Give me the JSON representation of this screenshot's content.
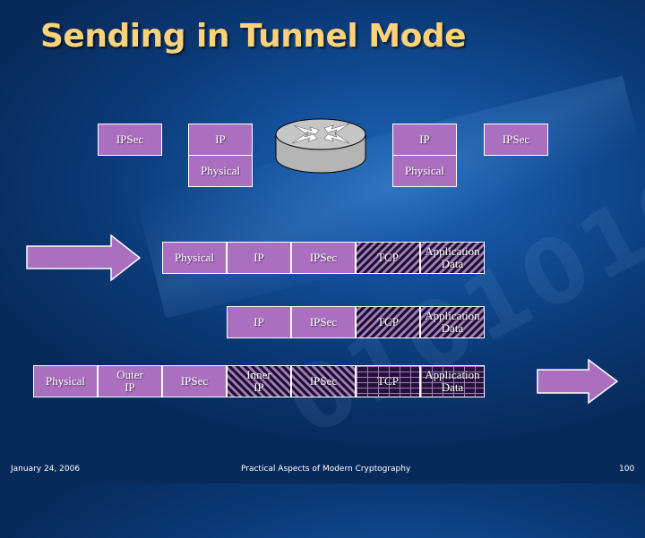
{
  "slide": {
    "title": "Sending in Tunnel Mode",
    "footer": {
      "date": "January 24, 2006",
      "course": "Practical Aspects of Modern Cryptography",
      "page_number": "100"
    }
  },
  "colors": {
    "title": "#fcd27a",
    "layer_fill": "#ab6fc0",
    "border": "#ffffff",
    "background": "#134f99"
  },
  "top_stack": {
    "left_ipsec": "IPSec",
    "left_ip": "IP",
    "left_physical": "Physical",
    "router_icon": "router-icon",
    "right_ip": "IP",
    "right_physical": "Physical",
    "right_ipsec": "IPSec"
  },
  "packets": {
    "row1": [
      {
        "label": "Physical",
        "pattern": "solid"
      },
      {
        "label": "IP",
        "pattern": "solid"
      },
      {
        "label": "IPSec",
        "pattern": "solid"
      },
      {
        "label": "TCP",
        "pattern": "hatch-forward"
      },
      {
        "label": "Application\nData",
        "pattern": "hatch-forward"
      }
    ],
    "row2": [
      {
        "label": "IP",
        "pattern": "solid"
      },
      {
        "label": "IPSec",
        "pattern": "solid"
      },
      {
        "label": "TCP",
        "pattern": "hatch-forward"
      },
      {
        "label": "Application\nData",
        "pattern": "hatch-forward"
      }
    ],
    "row3": [
      {
        "label": "Physical",
        "pattern": "solid"
      },
      {
        "label": "Outer\nIP",
        "pattern": "solid"
      },
      {
        "label": "IPSec",
        "pattern": "solid"
      },
      {
        "label": "Inner\nIP",
        "pattern": "hatch-back"
      },
      {
        "label": "IPSec",
        "pattern": "hatch-back"
      },
      {
        "label": "TCP",
        "pattern": "brick"
      },
      {
        "label": "Application\nData",
        "pattern": "brick"
      }
    ]
  },
  "arrows": {
    "incoming": "right-arrow-icon",
    "outgoing": "right-arrow-icon"
  }
}
